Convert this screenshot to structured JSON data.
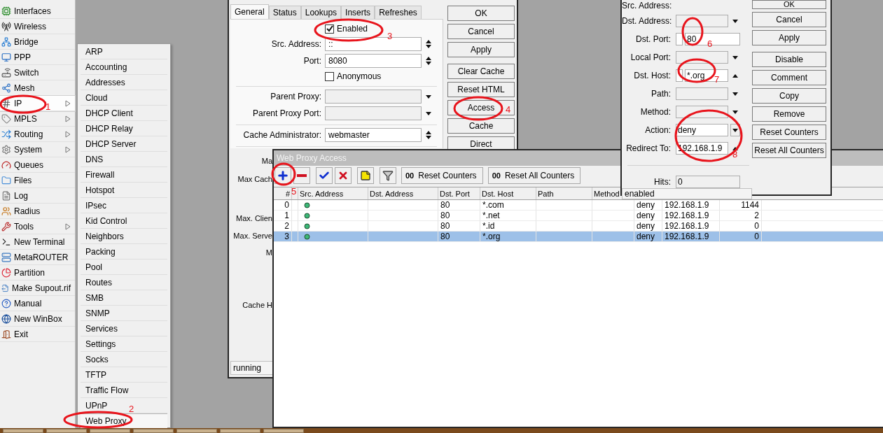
{
  "main_menu": {
    "items": [
      {
        "label": "Interfaces",
        "submenu": false,
        "selected": false
      },
      {
        "label": "Wireless",
        "submenu": false,
        "selected": false
      },
      {
        "label": "Bridge",
        "submenu": false,
        "selected": false
      },
      {
        "label": "PPP",
        "submenu": false,
        "selected": false
      },
      {
        "label": "Switch",
        "submenu": false,
        "selected": false
      },
      {
        "label": "Mesh",
        "submenu": false,
        "selected": false
      },
      {
        "label": "IP",
        "submenu": true,
        "selected": true
      },
      {
        "label": "MPLS",
        "submenu": true,
        "selected": false
      },
      {
        "label": "Routing",
        "submenu": true,
        "selected": false
      },
      {
        "label": "System",
        "submenu": true,
        "selected": false
      },
      {
        "label": "Queues",
        "submenu": false,
        "selected": false
      },
      {
        "label": "Files",
        "submenu": false,
        "selected": false
      },
      {
        "label": "Log",
        "submenu": false,
        "selected": false
      },
      {
        "label": "Radius",
        "submenu": false,
        "selected": false
      },
      {
        "label": "Tools",
        "submenu": true,
        "selected": false
      },
      {
        "label": "New Terminal",
        "submenu": false,
        "selected": false
      },
      {
        "label": "MetaROUTER",
        "submenu": false,
        "selected": false
      },
      {
        "label": "Partition",
        "submenu": false,
        "selected": false
      },
      {
        "label": "Make Supout.rif",
        "submenu": false,
        "selected": false
      },
      {
        "label": "Manual",
        "submenu": false,
        "selected": false
      },
      {
        "label": "New WinBox",
        "submenu": false,
        "selected": false
      },
      {
        "label": "Exit",
        "submenu": false,
        "selected": false
      }
    ]
  },
  "ip_submenu": {
    "items": [
      {
        "label": "ARP",
        "selected": false
      },
      {
        "label": "Accounting",
        "selected": false
      },
      {
        "label": "Addresses",
        "selected": false
      },
      {
        "label": "Cloud",
        "selected": false
      },
      {
        "label": "DHCP Client",
        "selected": false
      },
      {
        "label": "DHCP Relay",
        "selected": false
      },
      {
        "label": "DHCP Server",
        "selected": false
      },
      {
        "label": "DNS",
        "selected": false
      },
      {
        "label": "Firewall",
        "selected": false
      },
      {
        "label": "Hotspot",
        "selected": false
      },
      {
        "label": "IPsec",
        "selected": false
      },
      {
        "label": "Kid Control",
        "selected": false
      },
      {
        "label": "Neighbors",
        "selected": false
      },
      {
        "label": "Packing",
        "selected": false
      },
      {
        "label": "Pool",
        "selected": false
      },
      {
        "label": "Routes",
        "selected": false
      },
      {
        "label": "SMB",
        "selected": false
      },
      {
        "label": "SNMP",
        "selected": false
      },
      {
        "label": "Services",
        "selected": false
      },
      {
        "label": "Settings",
        "selected": false
      },
      {
        "label": "Socks",
        "selected": false
      },
      {
        "label": "TFTP",
        "selected": false
      },
      {
        "label": "Traffic Flow",
        "selected": false
      },
      {
        "label": "UPnP",
        "selected": false
      },
      {
        "label": "Web Proxy",
        "selected": true
      }
    ]
  },
  "proxy_settings": {
    "tabs": [
      {
        "label": "General",
        "selected": true
      },
      {
        "label": "Status",
        "selected": false
      },
      {
        "label": "Lookups",
        "selected": false
      },
      {
        "label": "Inserts",
        "selected": false
      },
      {
        "label": "Refreshes",
        "selected": false
      }
    ],
    "groups": [
      [
        {
          "kind": "checkbox",
          "label": "Enabled",
          "checked": true
        },
        {
          "kind": "spin",
          "label": "Src. Address:",
          "value": "::"
        },
        {
          "kind": "spin",
          "label": "Port:",
          "value": "8080"
        },
        {
          "kind": "checkbox",
          "label": "Anonymous",
          "checked": false
        }
      ],
      [
        {
          "kind": "dropdown",
          "label": "Parent Proxy:"
        },
        {
          "kind": "dropdown",
          "label": "Parent Proxy Port:"
        }
      ],
      [
        {
          "kind": "spin",
          "label": "Cache Administrator:",
          "value": "webmaster"
        }
      ]
    ],
    "covered_labels": [
      "Ma",
      "Max Cach",
      "Max. Clien",
      "Max. Serve",
      "M",
      "Cache H"
    ],
    "buttons": [
      "OK",
      "Cancel",
      "Apply",
      "Clear Cache",
      "Reset HTML",
      "Access",
      "Cache",
      "Direct"
    ],
    "status": "running"
  },
  "access_window": {
    "title": "Web Proxy Access",
    "toolbar": {
      "counter_buttons": [
        {
          "icon_text": "00",
          "label": "Reset Counters"
        },
        {
          "icon_text": "00",
          "label": "Reset All Counters"
        }
      ]
    },
    "columns": [
      "#",
      "Src. Address",
      "Dst. Address",
      "Dst. Port",
      "Dst. Host",
      "Path",
      "Method"
    ],
    "rows": [
      {
        "number": "0",
        "dst_port": "80",
        "dst_host": "*.com",
        "column_8": "deny",
        "column_9": "192.168.1.9",
        "column_10": "1144",
        "selected": false
      },
      {
        "number": "1",
        "dst_port": "80",
        "dst_host": "*.net",
        "column_8": "deny",
        "column_9": "192.168.1.9",
        "column_10": "2",
        "selected": false
      },
      {
        "number": "2",
        "dst_port": "80",
        "dst_host": "*.id",
        "column_8": "deny",
        "column_9": "192.168.1.9",
        "column_10": "0",
        "selected": false
      },
      {
        "number": "3",
        "dst_port": "80",
        "dst_host": "*.org",
        "column_8": "deny",
        "column_9": "192.168.1.9",
        "column_10": "0",
        "selected": true
      }
    ]
  },
  "rule_dialog": {
    "fields": [
      {
        "kind": "cut",
        "label": "Src. Address:"
      },
      {
        "kind": "dropdown",
        "label": "Dst. Address:"
      },
      {
        "kind": "invertible",
        "label": "Dst. Port:",
        "value": "80",
        "inverted": false
      },
      {
        "kind": "dropdown",
        "label": "Local Port:"
      },
      {
        "kind": "invertible_up",
        "label": "Dst. Host:",
        "value": "*.org",
        "inverted": false
      },
      {
        "kind": "dropdown",
        "label": "Path:"
      },
      {
        "kind": "dropdown",
        "label": "Method:"
      },
      {
        "kind": "select",
        "label": "Action:",
        "value": "deny"
      },
      {
        "kind": "up",
        "label": "Redirect To:",
        "value": "192.168.1.9"
      },
      {
        "kind": "readonly",
        "label": "Hits:",
        "value": "0"
      }
    ],
    "buttons": [
      "OK",
      "Cancel",
      "Apply",
      "Disable",
      "Comment",
      "Copy",
      "Remove",
      "Reset Counters",
      "Reset All Counters"
    ],
    "status": "enabled"
  },
  "annotations": [
    "1",
    "2",
    "3",
    "4",
    "5",
    "6",
    "7",
    "8"
  ]
}
